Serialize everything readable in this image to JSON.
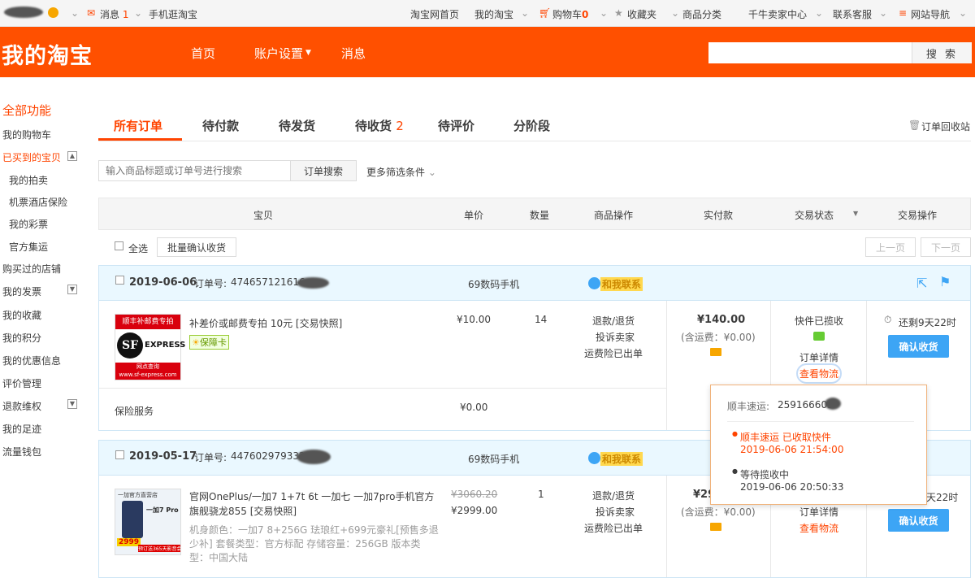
{
  "topbar": {
    "messages": "消息",
    "messages_count": "1",
    "mobile": "手机逛淘宝",
    "home": "淘宝网首页",
    "my": "我的淘宝",
    "cart": "购物车",
    "cart_count": "0",
    "fav": "收藏夹",
    "cat": "商品分类",
    "seller": "千牛卖家中心",
    "service": "联系客服",
    "sitenav": "网站导航"
  },
  "header": {
    "logo": "我的淘宝",
    "nav": [
      "首页",
      "账户设置",
      "消息"
    ],
    "search_btn": "搜 索"
  },
  "sidebar": [
    "全部功能",
    "我的购物车",
    "已买到的宝贝",
    "我的拍卖",
    "机票酒店保险",
    "我的彩票",
    "官方集运",
    "购买过的店铺",
    "我的发票",
    "我的收藏",
    "我的积分",
    "我的优惠信息",
    "评价管理",
    "退款维权",
    "我的足迹",
    "流量钱包"
  ],
  "tabs": {
    "all": "所有订单",
    "pay": "待付款",
    "ship": "待发货",
    "recv": "待收货",
    "recv_count": "2",
    "review": "待评价",
    "stage": "分阶段",
    "recycle": "订单回收站"
  },
  "search": {
    "placeholder": "输入商品标题或订单号进行搜索",
    "button": "订单搜索",
    "more": "更多筛选条件"
  },
  "table_header": [
    "宝贝",
    "单价",
    "数量",
    "商品操作",
    "实付款",
    "交易状态",
    "交易操作"
  ],
  "bulk": {
    "select_all": "全选",
    "confirm": "批量确认收货",
    "prev": "上一页",
    "next": "下一页"
  },
  "order1": {
    "date": "2019-06-06",
    "no_label": "订单号:",
    "no": "474657121616",
    "shop": "69数码手机",
    "contact": "和我联系",
    "img_top": "顺丰补邮费专拍",
    "img_brand": "EXPRESS",
    "img_sub": "网点查询",
    "img_url": "www.sf-express.com",
    "title": "补差价或邮费专拍 10元 [交易快照]",
    "badge": "保障卡",
    "price": "¥10.00",
    "qty": "14",
    "ops": [
      "退款/退货",
      "投诉卖家",
      "运费险已出单"
    ],
    "total": "¥140.00",
    "shipping": "(含运费：¥0.00)",
    "status": "快件已揽收",
    "detail": "订单详情",
    "logistics": "查看物流",
    "remain": "还剩9天22时",
    "confirm": "确认收货",
    "insurance": "保险服务",
    "insurance_price": "¥0.00"
  },
  "popup": {
    "company": "顺丰速运:",
    "track_no": "259166603",
    "e1_title": "顺丰速运 已收取快件",
    "e1_time": "2019-06-06 21:54:00",
    "e2_title": "等待揽收中",
    "e2_time": "2019-06-06 20:50:33"
  },
  "order2": {
    "date": "2019-05-17",
    "no_label": "订单号:",
    "no": "447602979332",
    "shop": "69数码手机",
    "contact": "和我联系",
    "img_top": "一加官方直营店",
    "img_phone": "一加7 Pro",
    "img_price": "2999",
    "img_promo": "预订送365天影音会员",
    "title_l1": "官网OnePlus/一加7 1+7t 6t 一加七 一加7pro手机官方",
    "title_l2": "旗舰骁龙855 [交易快照]",
    "spec_l1": "机身颜色：一加7 8+256G 珐琅红+699元豪礼[预售多退",
    "spec_l2": "少补] 套餐类型：官方标配 存储容量：256GB 版本类",
    "spec_l3": "型：中国大陆",
    "orig_price": "¥3060.20",
    "price": "¥2999.00",
    "qty": "1",
    "ops": [
      "退款/退货",
      "投诉卖家",
      "运费险已出单"
    ],
    "total": "¥29",
    "shipping": "(含运费：¥0.00)",
    "detail": "订单详情",
    "logistics": "查看物流",
    "remain": "天22时",
    "confirm": "确认收货"
  },
  "colors": {
    "brand": "#ff5000",
    "accent": "#f40",
    "blue": "#3da5f5"
  }
}
